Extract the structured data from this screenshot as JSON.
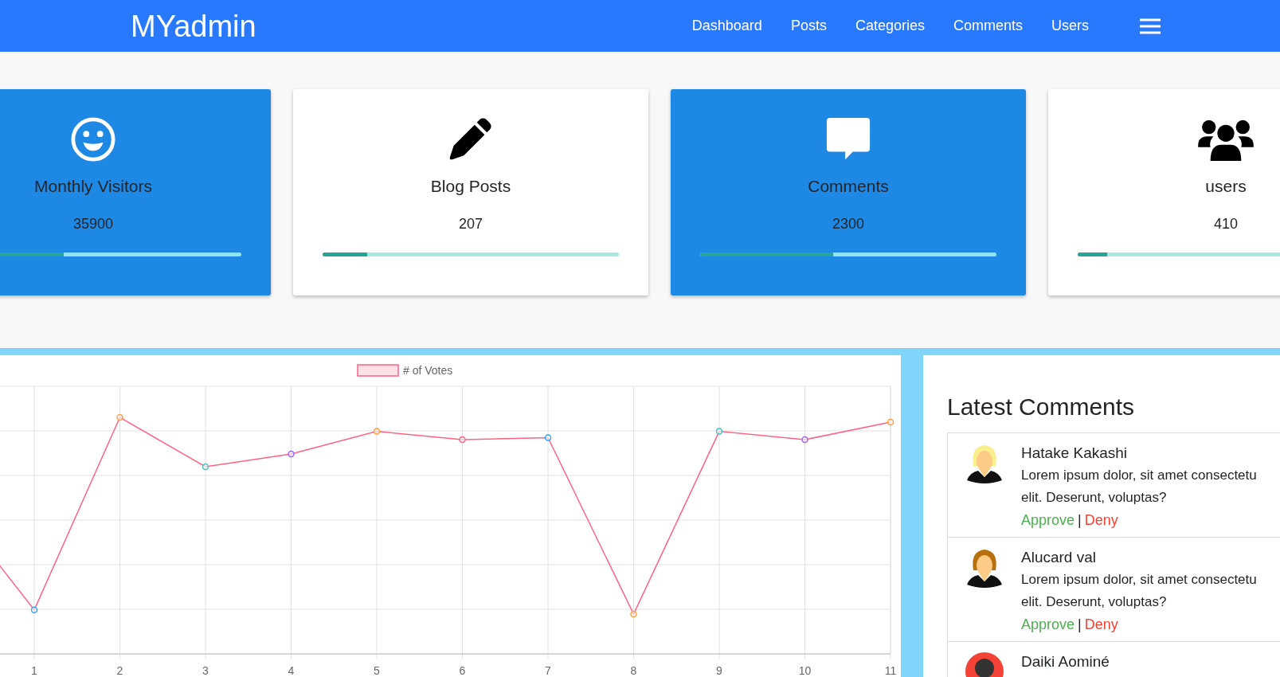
{
  "navbar": {
    "brand": "MYadmin",
    "links": [
      {
        "label": "Dashboard"
      },
      {
        "label": "Posts"
      },
      {
        "label": "Categories"
      },
      {
        "label": "Comments"
      },
      {
        "label": "Users"
      }
    ]
  },
  "stats": [
    {
      "kind": "filled",
      "title": "Monthly Visitors",
      "value": "35900",
      "level": 0.4
    },
    {
      "kind": "plain",
      "title": "Blog Posts",
      "value": "207",
      "level": 0.15
    },
    {
      "kind": "filled",
      "title": "Comments",
      "value": "2300",
      "level": 0.45
    },
    {
      "kind": "plain",
      "title": "users",
      "value": "410",
      "level": 0.1
    }
  ],
  "chart": {
    "legend": "# of Votes",
    "x_labels": [
      "1",
      "2",
      "3",
      "4",
      "5",
      "6",
      "7",
      "8",
      "9",
      "10",
      "11"
    ]
  },
  "latest_comments": {
    "title": "Latest Comments",
    "items": [
      {
        "name": "Hatake Kakashi",
        "lines": [
          "Lorem ipsum dolor, sit amet consectetu",
          "elit. Deserunt, voluptas?"
        ],
        "approve": "Approve",
        "separator": "|",
        "deny": "Deny"
      },
      {
        "name": "Alucard val",
        "lines": [
          "Lorem ipsum dolor, sit amet consectetu",
          "elit. Deserunt, voluptas?"
        ],
        "approve": "Approve",
        "separator": "|",
        "deny": "Deny"
      },
      {
        "name": "Daiki Aominé"
      }
    ]
  }
}
